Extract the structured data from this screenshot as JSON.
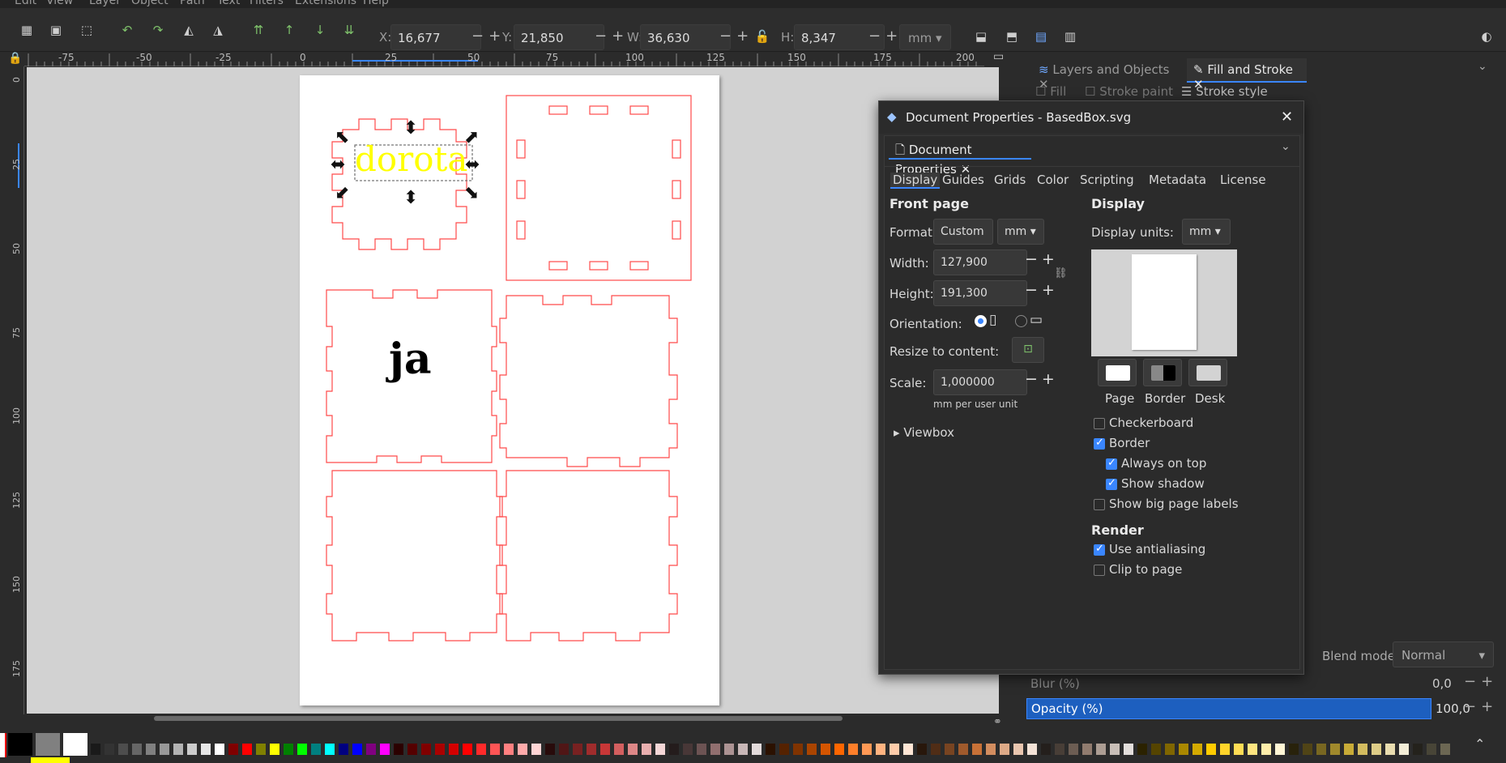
{
  "menu": [
    "Edit",
    "View",
    "Layer",
    "Object",
    "Path",
    "Text",
    "Filters",
    "Extensions",
    "Help"
  ],
  "toolbar": {
    "x_label": "X:",
    "x_value": "16,677",
    "y_label": "Y:",
    "y_value": "21,850",
    "w_label": "W:",
    "w_value": "36,630",
    "h_label": "H:",
    "h_value": "8,347",
    "unit": "mm"
  },
  "hruler_ticks": [
    "-75",
    "-50",
    "-25",
    "0",
    "25",
    "50",
    "75",
    "100",
    "125",
    "150",
    "175",
    "200"
  ],
  "vruler_ticks": [
    "0",
    "25",
    "50",
    "75",
    "100",
    "125",
    "150",
    "175"
  ],
  "canvas": {
    "text_selected": "dorota",
    "text_ja": "ja"
  },
  "right_panel": {
    "tab_layers": "Layers and Objects",
    "tab_fill": "Fill and Stroke",
    "sub_fill": "Fill",
    "sub_stroke_paint": "Stroke paint",
    "sub_stroke_style": "Stroke style",
    "blend_label": "Blend mode:",
    "blend_value": "Normal",
    "blur_label": "Blur (%)",
    "blur_value": "0,0",
    "opacity_label": "Opacity (%)",
    "opacity_value": "100,0"
  },
  "dialog": {
    "title": "Document Properties - BasedBox.svg",
    "tab_name": "Document Properties",
    "tabs": [
      "Display",
      "Guides",
      "Grids",
      "Color",
      "Scripting",
      "Metadata",
      "License"
    ],
    "front_page": "Front page",
    "format_label": "Format:",
    "format_value": "Custom",
    "format_unit": "mm",
    "width_label": "Width:",
    "width_value": "127,900",
    "height_label": "Height:",
    "height_value": "191,300",
    "orientation_label": "Orientation:",
    "resize_label": "Resize to content:",
    "scale_label": "Scale:",
    "scale_value": "1,000000",
    "scale_hint": "mm per user unit",
    "viewbox": "Viewbox",
    "display_hdr": "Display",
    "display_units_label": "Display units:",
    "display_units_value": "mm",
    "swatch_page": "Page",
    "swatch_border": "Border",
    "swatch_desk": "Desk",
    "checkboxes": [
      {
        "label": "Checkerboard",
        "checked": false
      },
      {
        "label": "Border",
        "checked": true
      },
      {
        "label": "Always on top",
        "checked": true
      },
      {
        "label": "Show shadow",
        "checked": true
      },
      {
        "label": "Show big page labels",
        "checked": false
      }
    ],
    "render_hdr": "Render",
    "render_checks": [
      {
        "label": "Use antialiasing",
        "checked": true
      },
      {
        "label": "Clip to page",
        "checked": false
      }
    ]
  },
  "palette_colors": [
    "#000000",
    "#808080",
    "#ffffff",
    "#1a1a1a",
    "#333333",
    "#4d4d4d",
    "#666666",
    "#808080",
    "#999999",
    "#b3b3b3",
    "#cccccc",
    "#e6e6e6",
    "#ffffff",
    "#800000",
    "#ff0000",
    "#808000",
    "#ffff00",
    "#008000",
    "#00ff00",
    "#008080",
    "#00ffff",
    "#000080",
    "#0000ff",
    "#800080",
    "#ff00ff",
    "#2b0000",
    "#550000",
    "#800000",
    "#aa0000",
    "#d40000",
    "#ff0000",
    "#ff2a2a",
    "#ff5555",
    "#ff8080",
    "#ffaaaa",
    "#ffd5d5",
    "#280b0b",
    "#501616",
    "#782121",
    "#a02c2c",
    "#c83737",
    "#d35f5f",
    "#de8787",
    "#e9afaf",
    "#f4d7d7",
    "#241c1c",
    "#483737",
    "#6c5353",
    "#916f6f",
    "#ac9393",
    "#c8b7b7",
    "#e3dbdb",
    "#2b1100",
    "#552200",
    "#803300",
    "#aa4400",
    "#d45500",
    "#ff6600",
    "#ff7f2a",
    "#ff9955",
    "#ffb380",
    "#ffccaa",
    "#ffe6d5",
    "#28170b",
    "#502d16",
    "#784421",
    "#a05a2c",
    "#c87137",
    "#d38d5f",
    "#deaa87",
    "#e9c6af",
    "#f4e3d7",
    "#241f1c",
    "#483e37",
    "#6c5d53",
    "#917c6f",
    "#ac9d93",
    "#c8beb7",
    "#e3dedb",
    "#2b2200",
    "#554400",
    "#806600",
    "#aa8800",
    "#d4aa00",
    "#ffcc00",
    "#ffd42a",
    "#ffdd55",
    "#ffe680",
    "#ffeeaa",
    "#fff6d5",
    "#28220b",
    "#504416",
    "#786721",
    "#a0892c",
    "#c8ab37",
    "#d3bc5f",
    "#decd87",
    "#e9ddaf",
    "#f4eed7",
    "#24221c",
    "#484537",
    "#6c6753"
  ]
}
